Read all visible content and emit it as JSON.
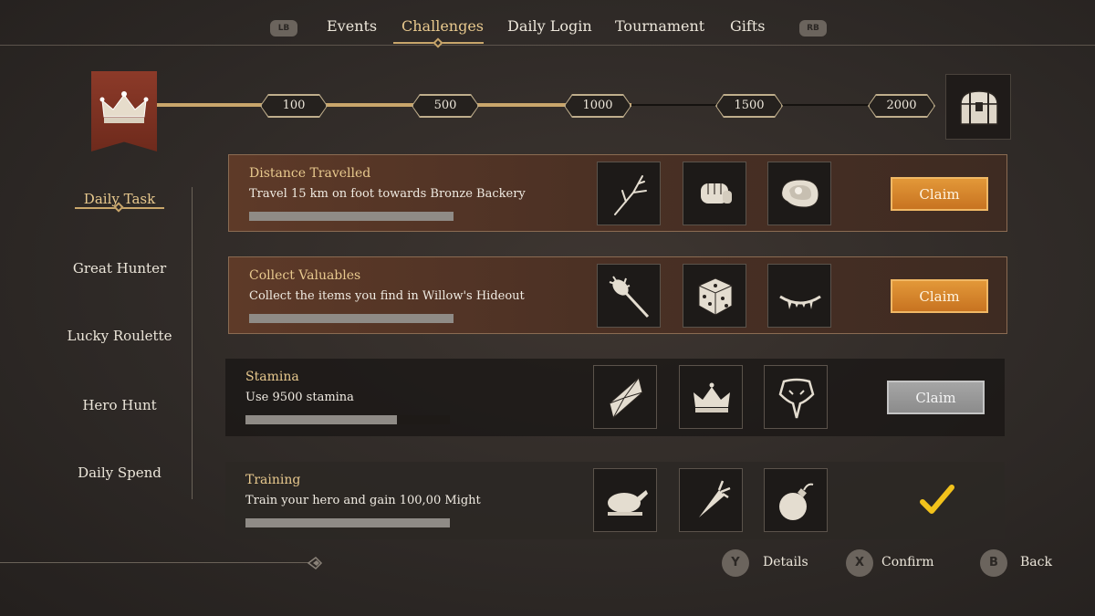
{
  "nav": {
    "lb": "LB",
    "rb": "RB",
    "tabs": [
      "Events",
      "Challenges",
      "Daily Login",
      "Tournament",
      "Gifts"
    ],
    "active_tab": "Challenges"
  },
  "progress": {
    "milestones": [
      "100",
      "500",
      "1000",
      "1500",
      "2000"
    ],
    "banner_icon": "crown-icon",
    "reward_icon": "treasure-chest-icon",
    "accent": "#c9a66b"
  },
  "sidebar": {
    "items": [
      "Daily Task",
      "Great Hunter",
      "Lucky Roulette",
      "Hero Hunt",
      "Daily Spend"
    ],
    "active": "Daily Task"
  },
  "tasks": [
    {
      "title": "Distance Travelled",
      "description": "Travel 15 km on foot towards Bronze Backery",
      "progress": 1.0,
      "rewards": [
        "branch-icon",
        "fist-icon",
        "steak-icon"
      ],
      "state": "claimable",
      "claim_label": "Claim"
    },
    {
      "title": "Collect Valuables",
      "description": "Collect the items you find in Willow's Hideout",
      "progress": 1.0,
      "rewards": [
        "mace-icon",
        "dice-icon",
        "fangs-icon"
      ],
      "state": "claimable",
      "claim_label": "Claim"
    },
    {
      "title": "Stamina",
      "description": "Use 9500 stamina",
      "progress": 0.74,
      "rewards": [
        "crystal-icon",
        "crown-icon",
        "serpent-icon"
      ],
      "state": "locked",
      "claim_label": "Claim"
    },
    {
      "title": "Training",
      "description": "Train your hero and gain 100,00 Might",
      "progress": 1.0,
      "rewards": [
        "roast-chicken-icon",
        "carrot-icon",
        "bomb-icon"
      ],
      "state": "claimed",
      "status_icon": "checkmark-icon"
    }
  ],
  "hints": [
    {
      "button": "Y",
      "label": "Details"
    },
    {
      "button": "X",
      "label": "Confirm"
    },
    {
      "button": "B",
      "label": "Back"
    }
  ],
  "colors": {
    "claim_active": "#d8832c",
    "claim_disabled": "#9a9a9a",
    "check": "#f2c21b",
    "gold_text": "#e8c98e"
  }
}
